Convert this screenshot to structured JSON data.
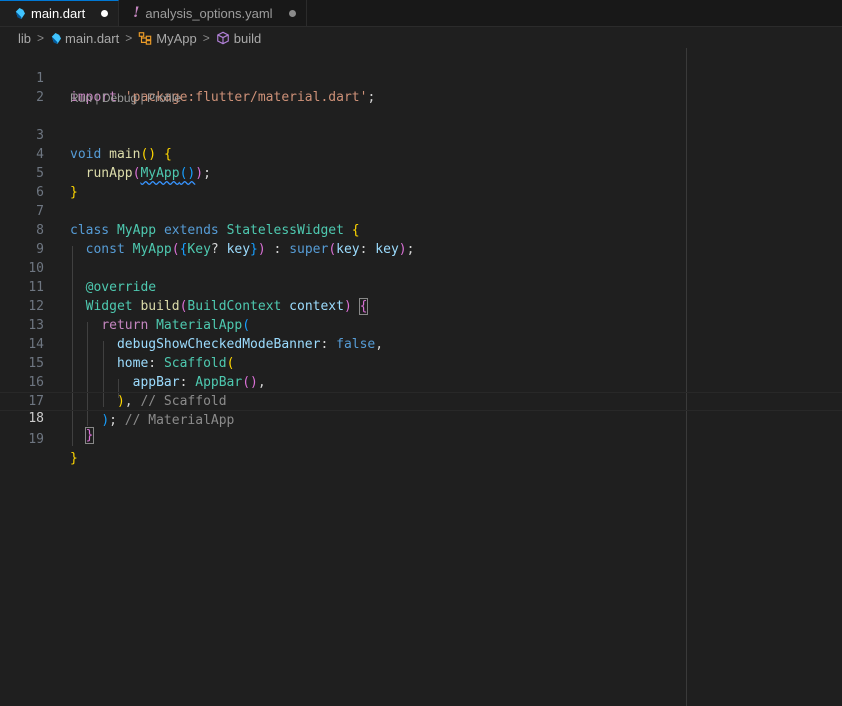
{
  "tabs": [
    {
      "label": "main.dart",
      "icon": "dart-icon",
      "modified": true
    },
    {
      "label": "analysis_options.yaml",
      "icon": "exclamation-icon",
      "modified": true
    }
  ],
  "breadcrumb": {
    "folder": "lib",
    "file": "main.dart",
    "class_symbol": "MyApp",
    "method_symbol": "build"
  },
  "codelens": {
    "run": "Run",
    "debug": "Debug",
    "profile": "Profile",
    "sep": " | "
  },
  "lines": {
    "n1": "1",
    "n2": "2",
    "n3": "3",
    "n4": "4",
    "n5": "5",
    "n6": "6",
    "n7": "7",
    "n8": "8",
    "n9": "9",
    "n10": "10",
    "n11": "11",
    "n12": "12",
    "n13": "13",
    "n14": "14",
    "n15": "15",
    "n16": "16",
    "n17": "17",
    "n18": "18",
    "n19": "19"
  },
  "code": {
    "import_kw": "import",
    "import_str": "'package:flutter/material.dart'",
    "void_kw": "void",
    "main_fn": "main",
    "runapp_fn": "runApp",
    "myapp": "MyApp",
    "class_kw": "class",
    "extends_kw": "extends",
    "stateless": "StatelessWidget",
    "const_kw": "const",
    "key_type": "Key",
    "key_var": "key",
    "super_kw": "super",
    "key_label": "key",
    "override": "@override",
    "widget_type": "Widget",
    "build_fn": "build",
    "buildcontext": "BuildContext",
    "context_var": "context",
    "return_kw": "return",
    "materialapp": "MaterialApp",
    "debug_prop": "debugShowCheckedModeBanner",
    "false_kw": "false",
    "home_prop": "home",
    "scaffold": "Scaffold",
    "appbar_prop": "appBar",
    "appbar_cls": "AppBar",
    "comment_scaffold": "// Scaffold",
    "comment_materialapp": "// MaterialApp"
  },
  "colors": {
    "accent": "#0078d4",
    "keyword": "#569cd6",
    "control": "#c586c0",
    "string": "#ce9178",
    "function": "#dcdcaa",
    "class": "#4ec9b0",
    "variable": "#9cdcfe"
  }
}
